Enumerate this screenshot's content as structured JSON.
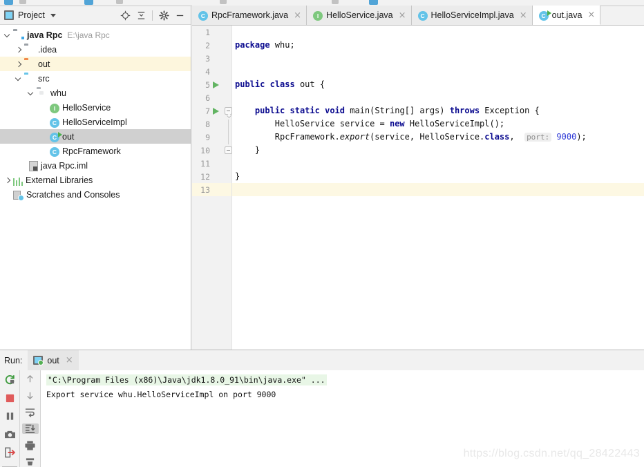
{
  "project_panel": {
    "title": "Project",
    "icons": [
      "project-view-icon",
      "locate-icon",
      "collapse-all-icon",
      "settings-gear-icon",
      "hide-icon"
    ],
    "tree": [
      {
        "label": "java Rpc",
        "path": "E:\\java Rpc",
        "kind": "module",
        "indent": 0,
        "expanded": true,
        "bold": true,
        "selected": "none"
      },
      {
        "label": ".idea",
        "path": "",
        "kind": "folder-grey",
        "indent": 1,
        "expanded": false,
        "bold": false,
        "selected": "none"
      },
      {
        "label": "out",
        "path": "",
        "kind": "folder-orange",
        "indent": 1,
        "expanded": false,
        "bold": false,
        "selected": "yellow"
      },
      {
        "label": "src",
        "path": "",
        "kind": "folder-blue",
        "indent": 1,
        "expanded": true,
        "bold": false,
        "selected": "none"
      },
      {
        "label": "whu",
        "path": "",
        "kind": "package",
        "indent": 2,
        "expanded": true,
        "bold": false,
        "selected": "none"
      },
      {
        "label": "HelloService",
        "path": "",
        "kind": "interface",
        "indent": 3,
        "expanded": null,
        "bold": false,
        "selected": "none"
      },
      {
        "label": "HelloServiceImpl",
        "path": "",
        "kind": "class",
        "indent": 3,
        "expanded": null,
        "bold": false,
        "selected": "none"
      },
      {
        "label": "out",
        "path": "",
        "kind": "class-runnable",
        "indent": 3,
        "expanded": null,
        "bold": false,
        "selected": "grey"
      },
      {
        "label": "RpcFramework",
        "path": "",
        "kind": "class",
        "indent": 3,
        "expanded": null,
        "bold": false,
        "selected": "none"
      },
      {
        "label": "java Rpc.iml",
        "path": "",
        "kind": "iml",
        "indent": 2,
        "expanded": null,
        "bold": false,
        "selected": "none"
      },
      {
        "label": "External Libraries",
        "path": "",
        "kind": "libraries",
        "indent": 0,
        "expanded": false,
        "bold": false,
        "selected": "none"
      },
      {
        "label": "Scratches and Consoles",
        "path": "",
        "kind": "scratches",
        "indent": 0,
        "expanded": null,
        "bold": false,
        "selected": "none"
      }
    ]
  },
  "editor": {
    "tabs": [
      {
        "label": "RpcFramework.java",
        "icon": "class-icon",
        "active": false
      },
      {
        "label": "HelloService.java",
        "icon": "interface-icon",
        "active": false
      },
      {
        "label": "HelloServiceImpl.java",
        "icon": "class-icon",
        "active": false
      },
      {
        "label": "out.java",
        "icon": "class-runnable-icon",
        "active": true
      }
    ],
    "close_glyph": "×",
    "current_line": 13,
    "lines": [
      {
        "n": 1,
        "run": false,
        "fold": "none",
        "text": ""
      },
      {
        "n": 2,
        "run": false,
        "fold": "none",
        "text": "package whu;"
      },
      {
        "n": 3,
        "run": false,
        "fold": "none",
        "text": ""
      },
      {
        "n": 4,
        "run": false,
        "fold": "none",
        "text": ""
      },
      {
        "n": 5,
        "run": true,
        "fold": "none",
        "text": "public class out {"
      },
      {
        "n": 6,
        "run": false,
        "fold": "none",
        "text": ""
      },
      {
        "n": 7,
        "run": true,
        "fold": "start",
        "text": "    public static void main(String[] args) throws Exception {"
      },
      {
        "n": 8,
        "run": false,
        "fold": "bar",
        "text": "        HelloService service = new HelloServiceImpl();"
      },
      {
        "n": 9,
        "run": false,
        "fold": "bar",
        "text": "        RpcFramework.export(service, HelloService.class,  port: 9000);"
      },
      {
        "n": 10,
        "run": false,
        "fold": "end",
        "text": "    }"
      },
      {
        "n": 11,
        "run": false,
        "fold": "none",
        "text": ""
      },
      {
        "n": 12,
        "run": false,
        "fold": "none",
        "text": "}"
      },
      {
        "n": 13,
        "run": false,
        "fold": "none",
        "text": ""
      }
    ],
    "code": {
      "l2_kw": "package",
      "l2_rest": " whu;",
      "l5_kw1": "public",
      "l5_kw2": "class",
      "l5_rest": " out {",
      "l7_kw1": "public",
      "l7_kw2": "static",
      "l7_kw3": "void",
      "l7_mid": " main(String[] args) ",
      "l7_kw4": "throws",
      "l7_rest": " Exception {",
      "l8_a": "        HelloService service = ",
      "l8_kw": "new",
      "l8_b": " HelloServiceImpl();",
      "l9_a": "        RpcFramework.",
      "l9_m": "export",
      "l9_b": "(service, HelloService.",
      "l9_kw": "class",
      "l9_c": ", ",
      "l9_hint": "port:",
      "l9_num": "9000",
      "l9_d": ");",
      "l10": "    }",
      "l12": "}"
    }
  },
  "run_panel": {
    "label": "Run:",
    "tab_label": "out",
    "close_glyph": "×",
    "tools_left": [
      "rerun-icon",
      "stop-icon",
      "pause-icon",
      "camera-icon",
      "export-icon"
    ],
    "tools_right": [
      "scroll-up-icon",
      "scroll-down-icon",
      "soft-wrap-icon",
      "scroll-to-end-icon",
      "print-icon",
      "clear-all-icon"
    ],
    "console_lines": [
      "\"C:\\Program Files (x86)\\Java\\jdk1.8.0_91\\bin\\java.exe\" ...",
      "Export service whu.HelloServiceImpl on port 9000"
    ]
  },
  "watermark": "https://blog.csdn.net/qq_28422443",
  "colors": {
    "keyword": "#0b0b8f",
    "number": "#2f3ad6",
    "run_green": "#62b462",
    "selection_grey": "#d0d0d0",
    "selection_yellow": "#fdf6dd",
    "console_cmd_bg": "#e8f6e6"
  }
}
